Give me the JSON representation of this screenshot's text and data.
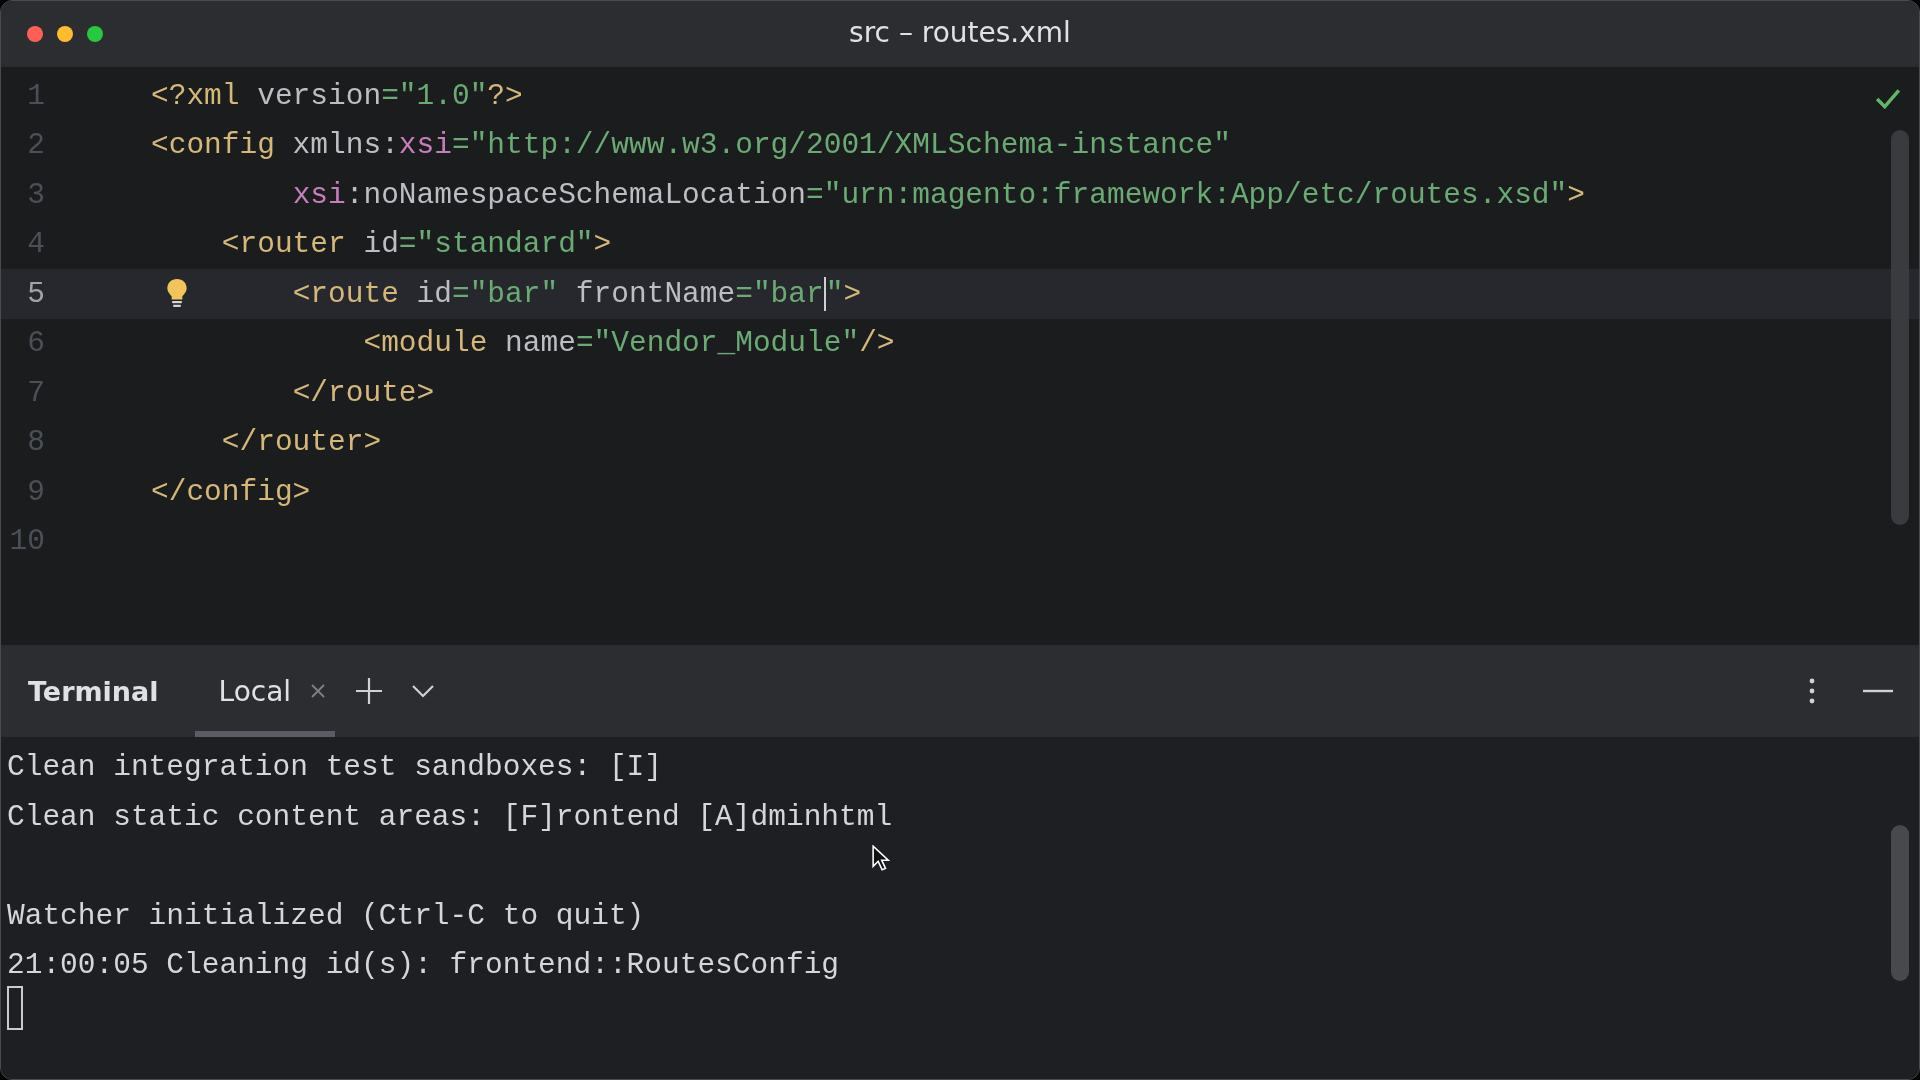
{
  "window": {
    "title": "src – routes.xml"
  },
  "editor": {
    "lines": [
      {
        "number": "1",
        "current": false,
        "bulb": false,
        "tokens": [
          {
            "kind": "tag",
            "text": "<?xml"
          },
          {
            "kind": "attr",
            "text": " version"
          },
          {
            "kind": "value",
            "text": "=\"1.0\""
          },
          {
            "kind": "tag",
            "text": "?>"
          }
        ]
      },
      {
        "number": "2",
        "current": false,
        "bulb": false,
        "tokens": [
          {
            "kind": "tag",
            "text": "<config"
          },
          {
            "kind": "attr",
            "text": " xmlns:"
          },
          {
            "kind": "ns",
            "text": "xsi"
          },
          {
            "kind": "value",
            "text": "=\"http://www.w3.org/2001/XMLSchema-instance\""
          }
        ]
      },
      {
        "number": "3",
        "current": false,
        "bulb": false,
        "tokens": [
          {
            "kind": "ns",
            "text": "        xsi"
          },
          {
            "kind": "attr",
            "text": ":noNamespaceSchemaLocation"
          },
          {
            "kind": "value",
            "text": "=\"urn:magento:framework:App/etc/routes.xsd\""
          },
          {
            "kind": "tag",
            "text": ">"
          }
        ]
      },
      {
        "number": "4",
        "current": false,
        "bulb": false,
        "tokens": [
          {
            "kind": "tag",
            "text": "    <router"
          },
          {
            "kind": "attr",
            "text": " id"
          },
          {
            "kind": "value",
            "text": "=\"standard\""
          },
          {
            "kind": "tag",
            "text": ">"
          }
        ]
      },
      {
        "number": "5",
        "current": true,
        "bulb": true,
        "tokens": [
          {
            "kind": "tag",
            "text": "        <route"
          },
          {
            "kind": "attr",
            "text": " id"
          },
          {
            "kind": "value",
            "text": "=\"bar\""
          },
          {
            "kind": "attr",
            "text": " frontName"
          },
          {
            "kind": "value",
            "text": "=\"bar",
            "caret": true
          },
          {
            "kind": "value",
            "text": "\""
          },
          {
            "kind": "tag",
            "text": ">"
          }
        ]
      },
      {
        "number": "6",
        "current": false,
        "bulb": false,
        "tokens": [
          {
            "kind": "tag",
            "text": "            <module"
          },
          {
            "kind": "attr",
            "text": " name"
          },
          {
            "kind": "value",
            "text": "=\"Vendor_Module\""
          },
          {
            "kind": "tag",
            "text": "/>"
          }
        ]
      },
      {
        "number": "7",
        "current": false,
        "bulb": false,
        "tokens": [
          {
            "kind": "tag",
            "text": "        </route>"
          }
        ]
      },
      {
        "number": "8",
        "current": false,
        "bulb": false,
        "tokens": [
          {
            "kind": "tag",
            "text": "    </router>"
          }
        ]
      },
      {
        "number": "9",
        "current": false,
        "bulb": false,
        "tokens": [
          {
            "kind": "tag",
            "text": "</config>"
          }
        ]
      },
      {
        "number": "10",
        "current": false,
        "bulb": false
      }
    ]
  },
  "terminal": {
    "title": "Terminal",
    "tabs": [
      {
        "label": "Local",
        "selected": true
      }
    ],
    "lines": [
      {
        "text": "Clean integration test sandboxes: [I]"
      },
      {
        "text": "Clean static content areas: [F]rontend [A]dminhtml"
      },
      {
        "text": "Watcher initialized (Ctrl-C to quit)",
        "blank_before": true
      },
      {
        "text": "21:00:05 Cleaning id(s): frontend::RoutesConfig"
      }
    ]
  }
}
